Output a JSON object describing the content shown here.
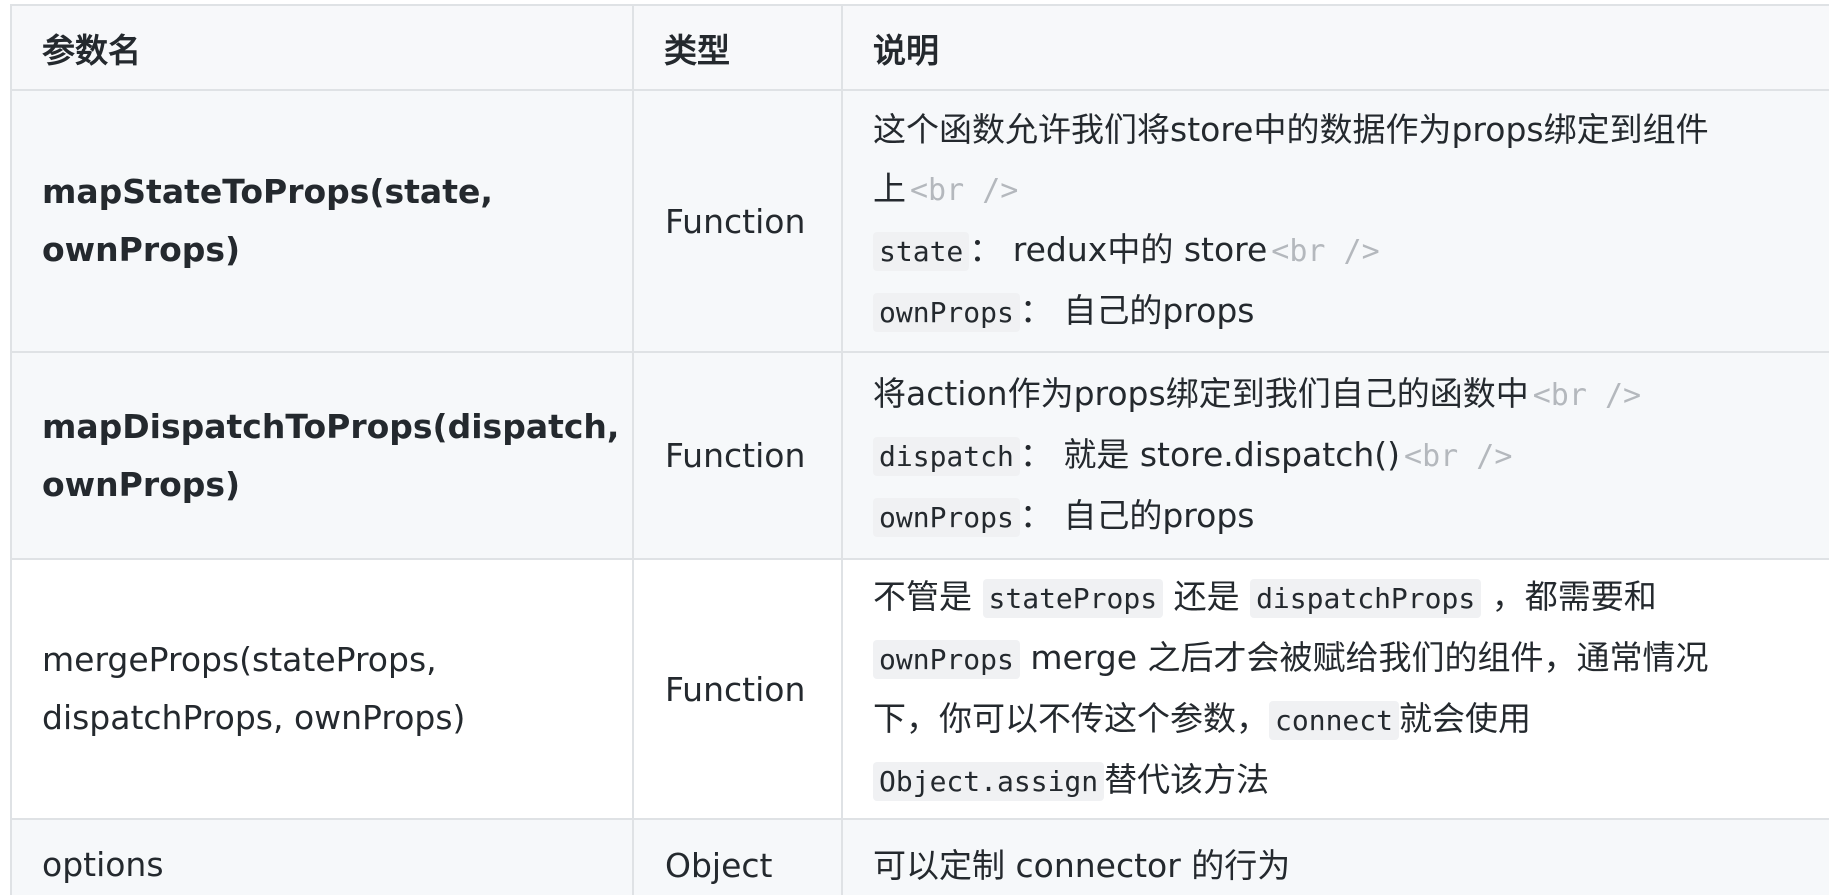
{
  "headers": [
    "参数名",
    "类型",
    "说明"
  ],
  "rows": [
    {
      "name": [
        "mapStateToProps(state,",
        "ownProps)"
      ],
      "type": "Function",
      "desc": {
        "l1": "这个函数允许我们将store中的数据作为props绑定到组件",
        "l2": "上",
        "l2_br": "<br />",
        "l3_code": "state",
        "l3_text": "： redux中的 store",
        "l3_br": "<br />",
        "l4_code": "ownProps",
        "l4_text": "： 自己的props"
      }
    },
    {
      "name": [
        "mapDispatchToProps(dispatch,",
        "ownProps)"
      ],
      "type": "Function",
      "desc": {
        "l1": "将action作为props绑定到我们自己的函数中",
        "l1_br": "<br />",
        "l2_code": "dispatch",
        "l2_text": "： 就是 store.dispatch()",
        "l2_br": "<br />",
        "l3_code": "ownProps",
        "l3_text": "： 自己的props"
      }
    },
    {
      "name": [
        "mergeProps(stateProps,",
        "dispatchProps, ownProps)"
      ],
      "type": "Function",
      "desc": {
        "l1_a": "不管是 ",
        "l1_code1": "stateProps",
        "l1_b": " 还是 ",
        "l1_code2": "dispatchProps",
        "l1_c": " ，都需要和",
        "l2_code": "ownProps",
        "l2_text": " merge 之后才会被赋给我们的组件，通常情况",
        "l3_text": "下，你可以不传这个参数，",
        "l3_code": "connect",
        "l3_text2": "就会使用",
        "l4_code": "Object.assign",
        "l4_text": "替代该方法"
      }
    },
    {
      "name": [
        "options"
      ],
      "type": "Object",
      "desc": {
        "l1": "可以定制 connector 的行为"
      }
    }
  ]
}
